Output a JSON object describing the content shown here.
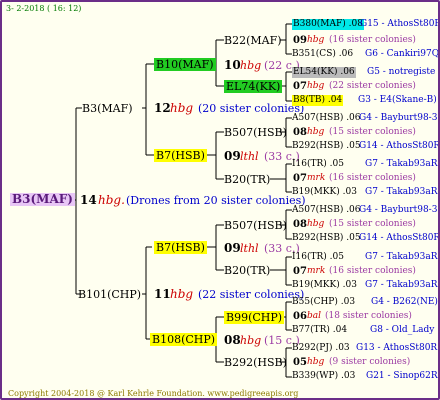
{
  "header": "3-  2-2018 ( 16: 12)",
  "footer": "Copyright 2004-2018 @ Karl Kehrle Foundation.   www.pedigreeapis.org",
  "colors": {
    "border": "#6b2e88",
    "root_bg": "#e8c6f5",
    "green": "#22cc22",
    "yellow": "#ffff00",
    "cyan": "#00e8e8",
    "gray": "#bbbbbb"
  },
  "root": {
    "label": "B3(MAF)",
    "gen": "14",
    "hbg": "hbg.",
    "note": "(Drones from 20 sister colonies)"
  },
  "g1": [
    {
      "label": "B3(MAF)",
      "gen": "12",
      "hbg": "hbg",
      "note": "(20 sister colonies)"
    },
    {
      "label": "B101(CHP)",
      "gen": "11",
      "hbg": "hbg",
      "note": "(22 sister colonies)"
    }
  ],
  "g2": [
    {
      "label": "B10(MAF)",
      "gen": "10",
      "hbg": "hbg",
      "note": "(22 c.)"
    },
    {
      "label": "B7(HSB)",
      "gen": "09",
      "hbg": "lthl",
      "note": "(33 c.)"
    },
    {
      "label": "B7(HSB)",
      "gen": "09",
      "hbg": "lthl",
      "note": "(33 c.)"
    },
    {
      "label": "B108(CHP)",
      "gen": "08",
      "hbg": "hbg",
      "note": "(15 c.)"
    }
  ],
  "g3": [
    {
      "label": "B22(MAF)"
    },
    {
      "label": "EL74(KK)"
    },
    {
      "label": "B507(HSB)"
    },
    {
      "label": "B20(TR)"
    },
    {
      "label": "B507(HSB)"
    },
    {
      "label": "B20(TR)"
    },
    {
      "label": "B99(CHP)"
    },
    {
      "label": "B292(HSB)"
    }
  ],
  "g4": [
    {
      "top": "B380(MAF) .08",
      "topr": "G15 - AthosSt80R",
      "gen": "09",
      "hbg": "hbg",
      "note": "(16 sister colonies)",
      "bot": "B351(CS) .06",
      "botr": "G6 - Cankiri97Q"
    },
    {
      "top": "EL54(KK) .06",
      "topr": "G5 - notregiste",
      "gen": "07",
      "hbg": "hbg",
      "note": "(22 sister colonies)",
      "bot": "B8(TB) .04",
      "botr": "G3 - E4(Skane-B)"
    },
    {
      "top": "A507(HSB) .06",
      "topr": "G4 - Bayburt98-3",
      "gen": "08",
      "hbg": "hbg",
      "note": "(15 sister colonies)",
      "bot": "B292(HSB) .05",
      "botr": "G14 - AthosSt80R"
    },
    {
      "top": "I16(TR) .05",
      "topr": "G7 - Takab93aR",
      "gen": "07",
      "hbg": "mrk",
      "note": "(16 sister colonies)",
      "bot": "B19(MKK) .03",
      "botr": "G7 - Takab93aR"
    },
    {
      "top": "A507(HSB) .06",
      "topr": "G4 - Bayburt98-3",
      "gen": "08",
      "hbg": "hbg",
      "note": "(15 sister colonies)",
      "bot": "B292(HSB) .05",
      "botr": "G14 - AthosSt80R"
    },
    {
      "top": "I16(TR) .05",
      "topr": "G7 - Takab93aR",
      "gen": "07",
      "hbg": "mrk",
      "note": "(16 sister colonies)",
      "bot": "B19(MKK) .03",
      "botr": "G7 - Takab93aR"
    },
    {
      "top": "B55(CHP) .03",
      "topr": "G4 - B262(NE)",
      "gen": "06",
      "hbg": "bal",
      "note": "(18 sister colonies)",
      "bot": "B77(TR) .04",
      "botr": "G8 - Old_Lady"
    },
    {
      "top": "B292(PJ) .03",
      "topr": "G13 - AthosSt80R",
      "gen": "05",
      "hbg": "hbg",
      "note": "(9 sister colonies)",
      "bot": "B339(WP) .03",
      "botr": "G21 - Sinop62R"
    }
  ]
}
